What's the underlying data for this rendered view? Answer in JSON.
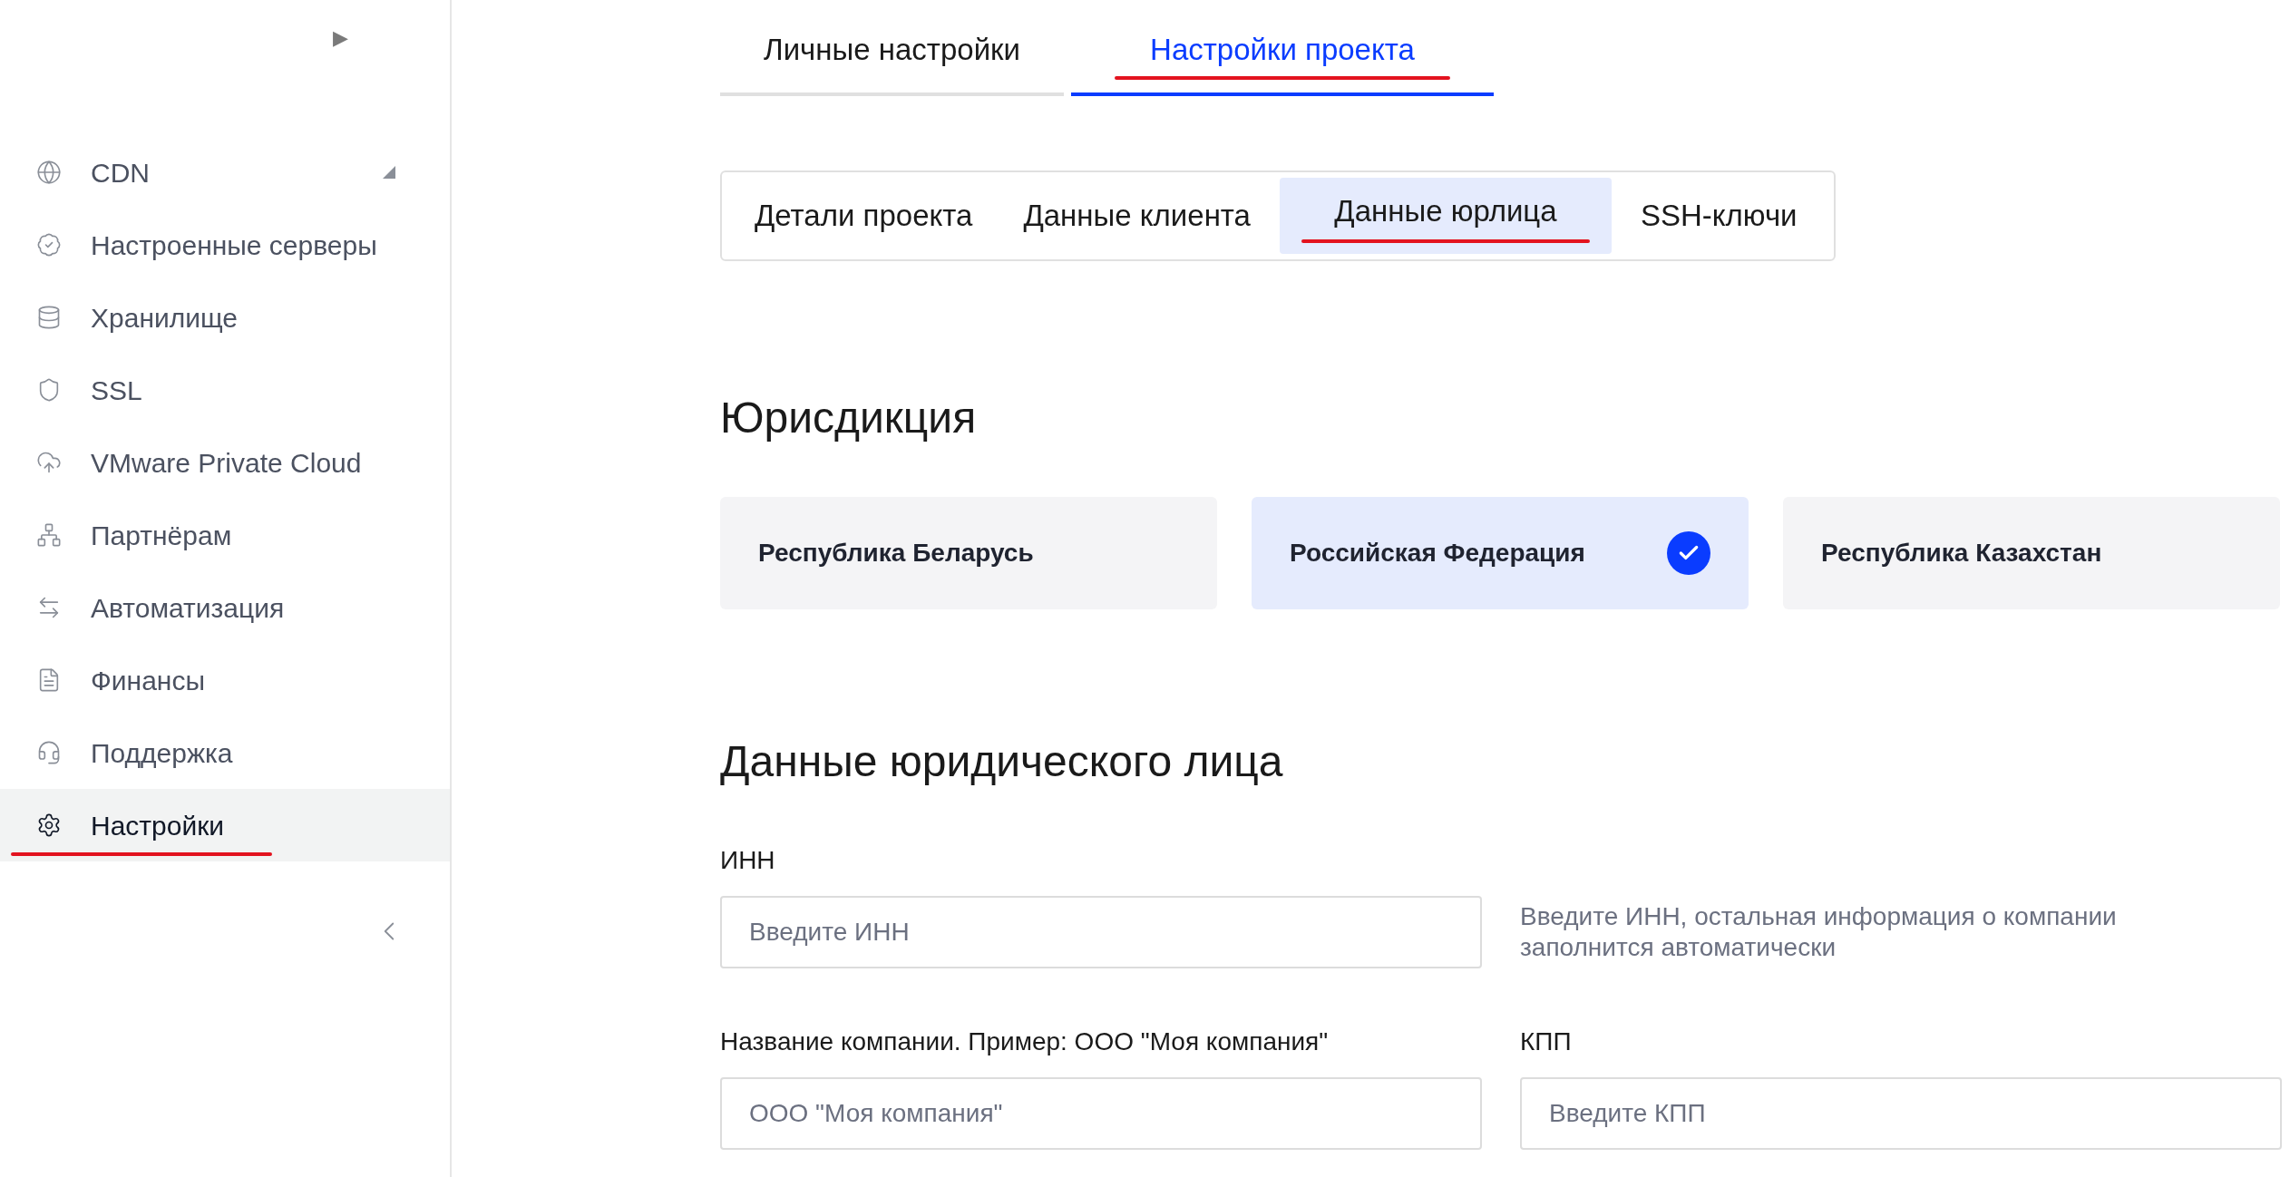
{
  "sidebar": {
    "toggle": "▶",
    "items": [
      {
        "label": "CDN",
        "expandable": true,
        "selected": false
      },
      {
        "label": "Настроенные серверы",
        "expandable": false,
        "selected": false
      },
      {
        "label": "Хранилище",
        "expandable": false,
        "selected": false
      },
      {
        "label": "SSL",
        "expandable": false,
        "selected": false
      },
      {
        "label": "VMware Private Cloud",
        "expandable": false,
        "selected": false
      },
      {
        "label": "Партнёрам",
        "expandable": false,
        "selected": false
      },
      {
        "label": "Автоматизация",
        "expandable": false,
        "selected": false
      },
      {
        "label": "Финансы",
        "expandable": false,
        "selected": false
      },
      {
        "label": "Поддержка",
        "expandable": false,
        "selected": false
      },
      {
        "label": "Настройки",
        "expandable": false,
        "selected": true
      }
    ]
  },
  "tabs": [
    {
      "label": "Личные настройки",
      "selected": false
    },
    {
      "label": "Настройки проекта",
      "selected": true
    }
  ],
  "subtabs": [
    {
      "label": "Детали проекта",
      "selected": false
    },
    {
      "label": "Данные клиента",
      "selected": false
    },
    {
      "label": "Данные юрлица",
      "selected": true
    },
    {
      "label": "SSH-ключи",
      "selected": false
    }
  ],
  "jurisdiction": {
    "heading": "Юрисдикция",
    "options": [
      {
        "label": "Республика Беларусь",
        "selected": false
      },
      {
        "label": "Российская Федерация",
        "selected": true
      },
      {
        "label": "Республика Казахстан",
        "selected": false
      }
    ]
  },
  "legal_entity": {
    "heading": "Данные юридического лица",
    "inn": {
      "label": "ИНН",
      "placeholder": "Введите ИНН",
      "hint": "Введите ИНН, остальная информация о компании заполнится автоматически"
    },
    "company": {
      "label": "Название компании. Пример: ООО \"Моя компания\"",
      "placeholder": "ООО \"Моя компания\""
    },
    "kpp": {
      "label": "КПП",
      "placeholder": "Введите КПП"
    }
  }
}
